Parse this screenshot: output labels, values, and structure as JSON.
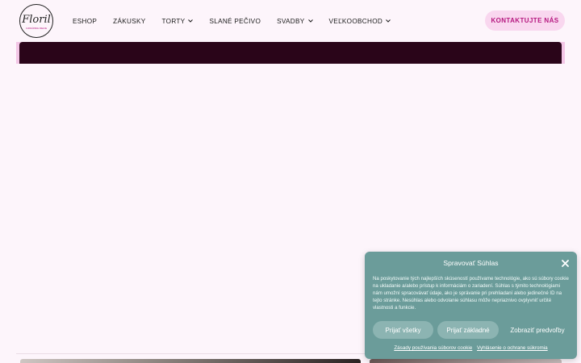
{
  "brand": {
    "logo_text": "Floril",
    "logo_subtext": "CUKRÁRSKE DIELNE"
  },
  "nav": {
    "items": [
      {
        "label": "ESHOP",
        "has_dropdown": false
      },
      {
        "label": "ZÁKUSKY",
        "has_dropdown": false
      },
      {
        "label": "TORTY",
        "has_dropdown": true
      },
      {
        "label": "SLANÉ PEČIVO",
        "has_dropdown": false
      },
      {
        "label": "SVADBY",
        "has_dropdown": true
      },
      {
        "label": "VEĽKOOBCHOD",
        "has_dropdown": true
      }
    ],
    "chevron_glyph": "⌄",
    "cta_label": "KONTAKTUJTE NÁS"
  },
  "colors": {
    "page_bg": "#fdf5fb",
    "accent": "#b5177f",
    "cta_bg": "#f9d7ef",
    "hero_bg": "#2a0519",
    "cookie_bg": "#6b9c9a",
    "cookie_button": "#8cb4b2"
  },
  "cookie": {
    "title": "Spravovať Súhlas",
    "close_glyph": "✕",
    "body": "Na poskytovanie tých najlepších skúseností používame technológie, ako sú súbory cookie na ukladanie a/alebo prístup k informáciám o zariadení. Súhlas s týmito technológiami nám umožní spracovávať údaje, ako je správanie pri prehliadaní alebo jedinečné ID na tejto stránke. Nesúhlas alebo odvolanie súhlasu môže nepriaznivo ovplyvniť určité vlastnosti a funkcie.",
    "accept_all": "Prijať všetky",
    "accept_basic": "Prijať základné",
    "show_prefs": "Zobraziť predvoľby",
    "link_cookie_policy": "Zásady používania súborov cookie",
    "link_privacy": "Vyhlásenie o ochrane súkromia"
  }
}
